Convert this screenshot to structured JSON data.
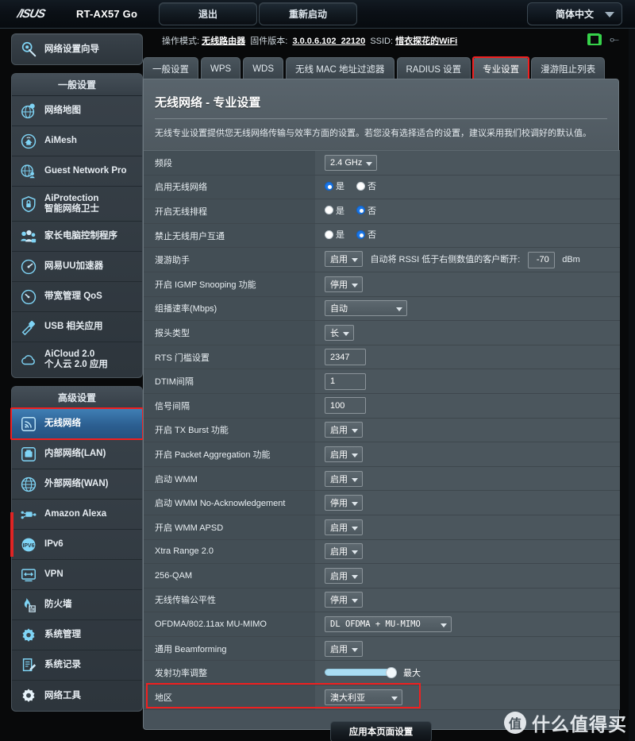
{
  "header": {
    "brand": "/ISUS",
    "model": "RT-AX57 Go",
    "logout_label": "退出",
    "reboot_label": "重新启动",
    "language": "简体中文"
  },
  "infobar": {
    "mode_label": "操作模式:",
    "mode_value": "无线路由器",
    "firmware_label": "固件版本:",
    "firmware_value": "3.0.0.6.102_22120",
    "ssid_label": "SSID:",
    "ssid_value": "惜衣探花的WiFi"
  },
  "sidebar": {
    "wizard": {
      "label": "网络设置向导",
      "icon": "wizard-icon"
    },
    "general_title": "一般设置",
    "general_items": [
      {
        "label": "网络地图",
        "icon": "network-map-icon"
      },
      {
        "label": "AiMesh",
        "icon": "aimesh-icon"
      },
      {
        "label": "Guest Network Pro",
        "icon": "guest-network-icon"
      },
      {
        "label": "AiProtection",
        "label2": "智能网络卫士",
        "icon": "shield-icon"
      },
      {
        "label": "家长电脑控制程序",
        "icon": "parental-control-icon"
      },
      {
        "label": "网易UU加速器",
        "icon": "accelerator-icon"
      },
      {
        "label": "带宽管理 QoS",
        "icon": "qos-icon"
      },
      {
        "label": "USB 相关应用",
        "icon": "usb-icon"
      },
      {
        "label": "AiCloud 2.0",
        "label2": "个人云 2.0 应用",
        "icon": "cloud-icon"
      }
    ],
    "advanced_title": "高级设置",
    "advanced_items": [
      {
        "label": "无线网络",
        "icon": "wireless-icon",
        "active": true
      },
      {
        "label": "内部网络(LAN)",
        "icon": "lan-icon"
      },
      {
        "label": "外部网络(WAN)",
        "icon": "wan-icon"
      },
      {
        "label": "Amazon Alexa",
        "icon": "alexa-icon"
      },
      {
        "label": "IPv6",
        "icon": "ipv6-icon"
      },
      {
        "label": "VPN",
        "icon": "vpn-icon"
      },
      {
        "label": "防火墙",
        "icon": "firewall-icon"
      },
      {
        "label": "系统管理",
        "icon": "administration-icon"
      },
      {
        "label": "系统记录",
        "icon": "system-log-icon"
      },
      {
        "label": "网络工具",
        "icon": "network-tools-icon"
      }
    ]
  },
  "tabs": [
    {
      "label": "一般设置",
      "active": false
    },
    {
      "label": "WPS",
      "active": false
    },
    {
      "label": "WDS",
      "active": false
    },
    {
      "label": "无线 MAC 地址过滤器",
      "active": false
    },
    {
      "label": "RADIUS 设置",
      "active": false
    },
    {
      "label": "专业设置",
      "active": true
    },
    {
      "label": "漫游阻止列表",
      "active": false
    }
  ],
  "panel": {
    "title": "无线网络 - 专业设置",
    "description": "无线专业设置提供您无线网络传输与效率方面的设置。若您没有选择适合的设置，建议采用我们校调好的默认值。",
    "apply_label": "应用本页面设置"
  },
  "form": {
    "rows": [
      {
        "label": "频段",
        "type": "select",
        "value": "2.4 GHz"
      },
      {
        "label": "启用无线网络",
        "type": "radio",
        "yes": "是",
        "no": "否",
        "selected": "yes"
      },
      {
        "label": "开启无线排程",
        "type": "radio",
        "yes": "是",
        "no": "否",
        "selected": "no"
      },
      {
        "label": "禁止无线用户互通",
        "type": "radio",
        "yes": "是",
        "no": "否",
        "selected": "no"
      },
      {
        "label": "漫游助手",
        "type": "roaming",
        "value": "启用",
        "text": "自动将 RSSI 低于右侧数值的客户断开:",
        "rssi": "-70",
        "unit": "dBm"
      },
      {
        "label": "开启 IGMP Snooping 功能",
        "type": "select",
        "value": "停用"
      },
      {
        "label": "组播速率(Mbps)",
        "type": "select-wide",
        "value": "自动"
      },
      {
        "label": "报头类型",
        "type": "select",
        "value": "长"
      },
      {
        "label": "RTS 门槛设置",
        "type": "text",
        "value": "2347"
      },
      {
        "label": "DTIM间隔",
        "type": "text",
        "value": "1"
      },
      {
        "label": "信号间隔",
        "type": "text",
        "value": "100"
      },
      {
        "label": "开启 TX Burst 功能",
        "type": "select",
        "value": "启用"
      },
      {
        "label": "开启 Packet Aggregation 功能",
        "type": "select",
        "value": "启用"
      },
      {
        "label": "启动 WMM",
        "type": "select",
        "value": "启用"
      },
      {
        "label": "启动 WMM No-Acknowledgement",
        "type": "select",
        "value": "停用"
      },
      {
        "label": "开启 WMM APSD",
        "type": "select",
        "value": "启用"
      },
      {
        "label": "Xtra Range 2.0",
        "type": "select",
        "value": "启用"
      },
      {
        "label": "256-QAM",
        "type": "select",
        "value": "启用"
      },
      {
        "label": "无线传输公平性",
        "type": "select",
        "value": "停用"
      },
      {
        "label": "OFDMA/802.11ax MU-MIMO",
        "type": "select-ofdma",
        "value": "DL OFDMA + MU-MIMO"
      },
      {
        "label": "通用 Beamforming",
        "type": "select",
        "value": "启用"
      },
      {
        "label": "发射功率调整",
        "type": "slider",
        "value": "最大",
        "percent": 100
      },
      {
        "label": "地区",
        "type": "select-region",
        "value": "澳大利亚",
        "highlight": true
      }
    ]
  },
  "watermark": {
    "logo": "值",
    "text": "什么值得买"
  },
  "colors": {
    "accent_blue": "#2c5f91",
    "highlight_red": "#f02020",
    "panel_bg": "#4b565d",
    "label_bg": "#434e55",
    "icon_blue": "#7fd4f5"
  }
}
